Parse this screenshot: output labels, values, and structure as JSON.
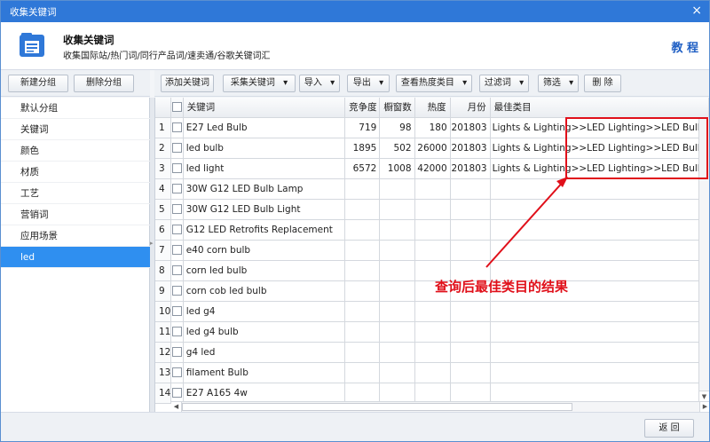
{
  "window": {
    "title": "收集关键词",
    "close_glyph": "×"
  },
  "header": {
    "title": "收集关键词",
    "subtitle": "收集国际站/热门词/同行产品词/速卖通/谷歌关键词汇",
    "tutorial_link": "教 程",
    "icon": "folder-list-icon"
  },
  "left_toolbar": {
    "new_group": "新建分组",
    "delete_group": "删除分组"
  },
  "sidebar": {
    "items": [
      {
        "label": "默认分组"
      },
      {
        "label": "关键词"
      },
      {
        "label": "颜色"
      },
      {
        "label": "材质"
      },
      {
        "label": "工艺"
      },
      {
        "label": "营销词"
      },
      {
        "label": "应用场景"
      },
      {
        "label": "led"
      }
    ],
    "active": "led"
  },
  "toolbar": {
    "add_keyword": "添加关键词",
    "collect_keyword": "采集关键词",
    "import": "导入",
    "export": "导出",
    "view_category": "查看热度类目",
    "filter_words": "过滤词",
    "screen": "筛选",
    "delete": "删 除",
    "dropdown_glyph": "▾"
  },
  "table": {
    "columns": [
      "关键词",
      "竞争度",
      "橱窗数",
      "热度",
      "月份",
      "最佳类目"
    ],
    "rows": [
      {
        "no": "1",
        "keyword": "E27 Led Bulb",
        "competition": "719",
        "showcase": "98",
        "heat": "180",
        "month": "201803",
        "category": "Lights & Lighting>>LED Lighting>>LED Bulbs"
      },
      {
        "no": "2",
        "keyword": "led bulb",
        "competition": "1895",
        "showcase": "502",
        "heat": "26000",
        "month": "201803",
        "category": "Lights & Lighting>>LED Lighting>>LED Bulbs"
      },
      {
        "no": "3",
        "keyword": "led light",
        "competition": "6572",
        "showcase": "1008",
        "heat": "42000",
        "month": "201803",
        "category": "Lights & Lighting>>LED Lighting>>LED Bulbs"
      },
      {
        "no": "4",
        "keyword": "30W G12 LED Bulb Lamp",
        "competition": "",
        "showcase": "",
        "heat": "",
        "month": "",
        "category": ""
      },
      {
        "no": "5",
        "keyword": "30W G12 LED Bulb Light",
        "competition": "",
        "showcase": "",
        "heat": "",
        "month": "",
        "category": ""
      },
      {
        "no": "6",
        "keyword": "G12 LED Retrofits Replacement",
        "competition": "",
        "showcase": "",
        "heat": "",
        "month": "",
        "category": ""
      },
      {
        "no": "7",
        "keyword": "e40 corn bulb",
        "competition": "",
        "showcase": "",
        "heat": "",
        "month": "",
        "category": ""
      },
      {
        "no": "8",
        "keyword": "corn led bulb",
        "competition": "",
        "showcase": "",
        "heat": "",
        "month": "",
        "category": ""
      },
      {
        "no": "9",
        "keyword": "corn cob led bulb",
        "competition": "",
        "showcase": "",
        "heat": "",
        "month": "",
        "category": ""
      },
      {
        "no": "10",
        "keyword": "led g4",
        "competition": "",
        "showcase": "",
        "heat": "",
        "month": "",
        "category": ""
      },
      {
        "no": "11",
        "keyword": "led g4 bulb",
        "competition": "",
        "showcase": "",
        "heat": "",
        "month": "",
        "category": ""
      },
      {
        "no": "12",
        "keyword": "g4 led",
        "competition": "",
        "showcase": "",
        "heat": "",
        "month": "",
        "category": ""
      },
      {
        "no": "13",
        "keyword": "filament  Bulb",
        "competition": "",
        "showcase": "",
        "heat": "",
        "month": "",
        "category": ""
      },
      {
        "no": "14",
        "keyword": "E27 A165 4w",
        "competition": "",
        "showcase": "",
        "heat": "",
        "month": "",
        "category": ""
      }
    ]
  },
  "annotation": {
    "text": "查询后最佳类目的结果",
    "color": "#e0101a"
  },
  "footer": {
    "back": "返 回"
  },
  "colors": {
    "titlebar": "#2f78d8",
    "accent": "#2f8ff0",
    "highlight": "#e0101a",
    "link": "#1f5fc4"
  }
}
